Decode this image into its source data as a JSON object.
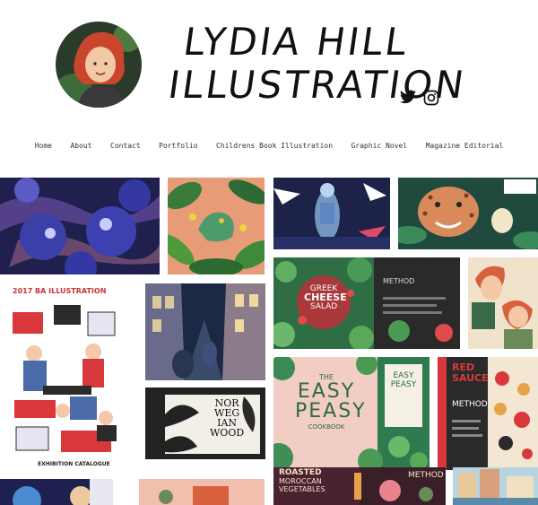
{
  "site": {
    "logo_line1": "LYDIA HILL",
    "logo_line2": "ILLUSTRATION"
  },
  "social": {
    "icons": [
      "twitter-icon",
      "instagram-icon"
    ]
  },
  "nav": {
    "items": [
      "Home",
      "About",
      "Contact",
      "Portfolio",
      "Childrens Book Illustration",
      "Graphic Novel",
      "Magazine Editorial"
    ]
  },
  "gallery": {
    "ba_title": "2017 BA ILLUSTRATION",
    "ba_sub": "EXHIBITION CATALOGUE",
    "greek1": "GREEK",
    "greek2": "CHEESE",
    "greek3": "SALAD",
    "method": "METHOD",
    "norwegian1": "NOR",
    "norwegian2": "WEG",
    "norwegian3": "IAN",
    "norwegian4": "WOOD",
    "easy1": "THE",
    "easy2": "EASY",
    "easy3": "PEASY",
    "cookbook": "COOKBOOK",
    "small_easy": "EASY",
    "small_peasy": "PEASY",
    "red_sauce1": "RED",
    "red_sauce2": "SAUCE",
    "roasted1": "ROASTED",
    "roasted2": "MOROCCAN",
    "roasted3": "VEGETABLES"
  },
  "colors": {
    "accent_red": "#d8383c",
    "leaf_green": "#2e7a4a",
    "navy": "#1e2050"
  }
}
